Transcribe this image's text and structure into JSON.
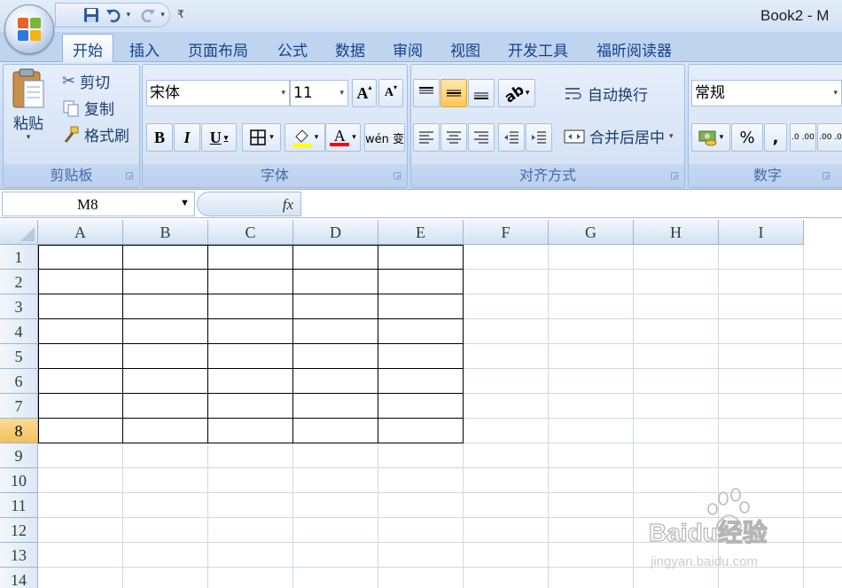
{
  "app": {
    "window_title": "Book2 - M"
  },
  "quick_access": {
    "save_icon": "save-icon",
    "undo_icon": "undo-icon",
    "redo_icon": "redo-icon",
    "more_icon": "customize-qat-icon"
  },
  "tabs": [
    {
      "label": "开始",
      "active": true
    },
    {
      "label": "插入"
    },
    {
      "label": "页面布局"
    },
    {
      "label": "公式"
    },
    {
      "label": "数据"
    },
    {
      "label": "审阅"
    },
    {
      "label": "视图"
    },
    {
      "label": "开发工具"
    },
    {
      "label": "福昕阅读器"
    }
  ],
  "clipboard": {
    "group_label": "剪贴板",
    "paste_label": "粘贴",
    "cut_label": "剪切",
    "copy_label": "复制",
    "format_painter_label": "格式刷"
  },
  "font": {
    "group_label": "字体",
    "font_name": "宋体",
    "font_size": "11",
    "bold": "B",
    "italic": "I",
    "underline": "U",
    "font_color_letter": "A",
    "phonetic": "wén 变",
    "grow_a": "A",
    "shrink_a": "A"
  },
  "alignment": {
    "group_label": "对齐方式",
    "wrap_text_label": "自动换行",
    "merge_center_label": "合并后居中"
  },
  "number": {
    "group_label": "数字",
    "format_value": "常规",
    "percent": "%",
    "comma": ",",
    "inc_decimal": ".0 .00",
    "dec_decimal": ".00 .0"
  },
  "formula_bar": {
    "name_box": "M8",
    "fx_label": "fx",
    "formula": ""
  },
  "sheet": {
    "columns": [
      "A",
      "B",
      "C",
      "D",
      "E",
      "F",
      "G",
      "H",
      "I"
    ],
    "rows": [
      "1",
      "2",
      "3",
      "4",
      "5",
      "6",
      "7",
      "8",
      "9",
      "10",
      "11",
      "12",
      "13",
      "14"
    ],
    "selected_row": "8"
  },
  "watermark": {
    "brand": "Baidu经验",
    "url": "jingyan.baidu.com"
  },
  "colors": {
    "ribbon_bg": "#c6daf3",
    "header_bg": "#dde7f4",
    "selected_header": "#f3c15c",
    "text_blue": "#15428b"
  }
}
